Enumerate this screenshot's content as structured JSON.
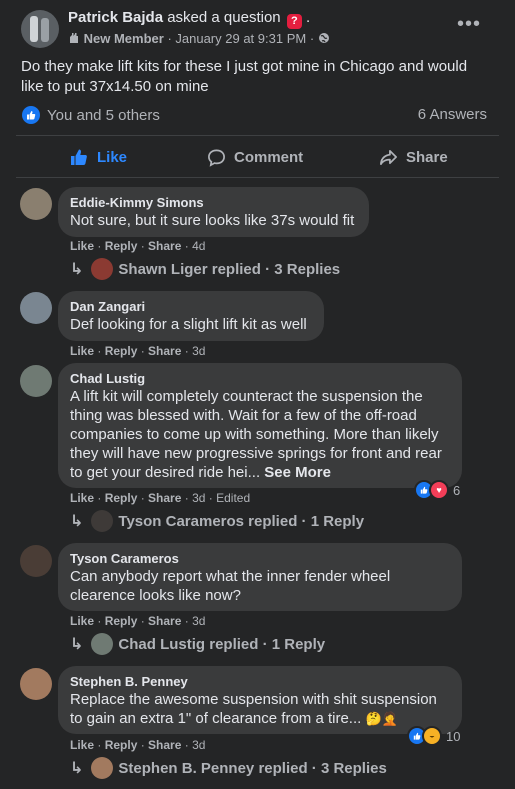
{
  "post": {
    "author": "Patrick Bajda",
    "action_text": " asked a question ",
    "question_icon": "?",
    "trailing": " .",
    "badge": "New Member",
    "timestamp": "January 29 at 9:31 PM",
    "sep": " · ",
    "text": "Do they make lift kits for these I just got mine in Chicago and would like to put 37x14.50 on mine",
    "reactions_text": "You and 5 others",
    "answers_text": "6 Answers",
    "more_icon": "•••"
  },
  "actions": {
    "like": "Like",
    "comment": "Comment",
    "share": "Share"
  },
  "comment_actions": {
    "like": "Like",
    "reply": "Reply",
    "share": "Share",
    "dot": " · "
  },
  "comments": [
    {
      "name": "Eddie-Kimmy Simons",
      "text": "Not sure, but it sure looks like 37s would fit",
      "time": "4d",
      "reply": "Shawn Liger replied · 3 Replies"
    },
    {
      "name": "Dan Zangari",
      "text": "Def looking for a slight lift kit as well",
      "time": "3d"
    },
    {
      "name": "Chad Lustig",
      "text": "A lift kit will completely counteract the suspension the thing was blessed with. Wait for a few of the off-road companies to come up with something. More than likely they will have new progressive springs for front and rear to get your desired ride hei...",
      "see_more": "See More",
      "time": "3d",
      "edited": "Edited",
      "reaction_count": "6",
      "reply": "Tyson Carameros replied · 1 Reply"
    },
    {
      "name": "Tyson Carameros",
      "text": "Can anybody report what the inner fender wheel clearence looks like now?",
      "time": "3d",
      "reply": "Chad Lustig replied · 1 Reply"
    },
    {
      "name": "Stephen B. Penney",
      "text": "Replace the awesome suspension with shit suspension to gain an extra 1\" of clearance from a tire...",
      "emoji": "🤔🤦",
      "time": "3d",
      "reaction_count": "10",
      "reply": "Stephen B. Penney replied · 3 Replies"
    }
  ],
  "colors": {
    "background": "#242526",
    "bubble": "#3a3b3c",
    "accent": "#2d88ff",
    "secondary_text": "#b0b3b8"
  }
}
